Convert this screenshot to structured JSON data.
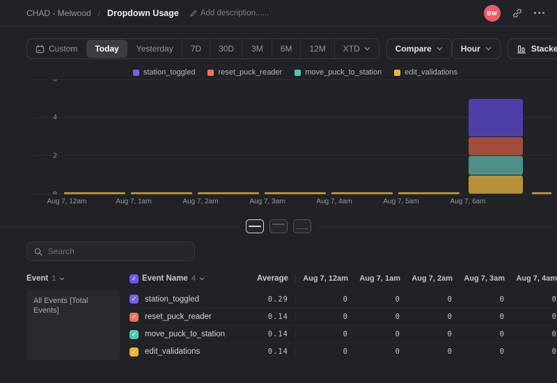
{
  "breadcrumb": {
    "project": "CHAD - Melwood",
    "separator": "/",
    "title": "Dropdown Usage",
    "add_description": "Add description......"
  },
  "header": {
    "avatar_initials": "BW"
  },
  "toolbar": {
    "date_ranges": [
      "Custom",
      "Today",
      "Yesterday",
      "7D",
      "30D",
      "3M",
      "6M",
      "12M",
      "XTD"
    ],
    "selected_range": "Today",
    "ranges_with_chevron": [
      "XTD"
    ],
    "compare_label": "Compare",
    "granularity_label": "Hour",
    "chart_type_label": "Stacked Column"
  },
  "chart_data": {
    "type": "bar",
    "stacked": true,
    "title": "",
    "xlabel": "",
    "ylabel": "",
    "ylim": [
      0,
      6
    ],
    "yticks": [
      0,
      2,
      4,
      6
    ],
    "grid": true,
    "legend_position": "top",
    "categories": [
      "Aug 7, 12am",
      "Aug 7, 1am",
      "Aug 7, 2am",
      "Aug 7, 3am",
      "Aug 7, 4am",
      "Aug 7, 5am",
      "Aug 7, 6am",
      ""
    ],
    "series": [
      {
        "name": "station_toggled",
        "color": "#7b5cf0",
        "bar_color": "#4c40a8",
        "values": [
          0,
          0,
          0,
          0,
          0,
          0,
          2,
          0
        ]
      },
      {
        "name": "reset_puck_reader",
        "color": "#f4705a",
        "bar_color": "#a34d3e",
        "values": [
          0,
          0,
          0,
          0,
          0,
          0,
          1,
          0
        ]
      },
      {
        "name": "move_puck_to_station",
        "color": "#4fc8b8",
        "bar_color": "#4e9088",
        "values": [
          0,
          0,
          0,
          0,
          0,
          0,
          1,
          0
        ]
      },
      {
        "name": "edit_validations",
        "color": "#f2b03c",
        "bar_color": "#b7923a",
        "values": [
          0,
          0,
          0,
          0,
          0,
          0,
          1,
          0
        ]
      }
    ],
    "zero_sliver_color": "#c2952f"
  },
  "table": {
    "search_placeholder": "Search",
    "event_col": {
      "label": "Event",
      "count": "1"
    },
    "event_name_col": {
      "label": "Event Name",
      "count": "4"
    },
    "average_label": "Average",
    "date_columns": [
      "Aug 7, 12am",
      "Aug 7, 1am",
      "Aug 7, 2am",
      "Aug 7, 3am",
      "Aug 7, 4am"
    ],
    "group_label": "All Events [Total Events]",
    "rows": [
      {
        "name": "station_toggled",
        "color": "#7b5cf0",
        "average": "0.29",
        "values": [
          "0",
          "0",
          "0",
          "0",
          "0"
        ]
      },
      {
        "name": "reset_puck_reader",
        "color": "#f4705a",
        "average": "0.14",
        "values": [
          "0",
          "0",
          "0",
          "0",
          "0"
        ]
      },
      {
        "name": "move_puck_to_station",
        "color": "#4fc8b8",
        "average": "0.14",
        "values": [
          "0",
          "0",
          "0",
          "0",
          "0"
        ]
      },
      {
        "name": "edit_validations",
        "color": "#f2b03c",
        "average": "0.14",
        "values": [
          "0",
          "0",
          "0",
          "0",
          "0"
        ]
      }
    ],
    "header_checkbox_color": "#6f58ee"
  }
}
